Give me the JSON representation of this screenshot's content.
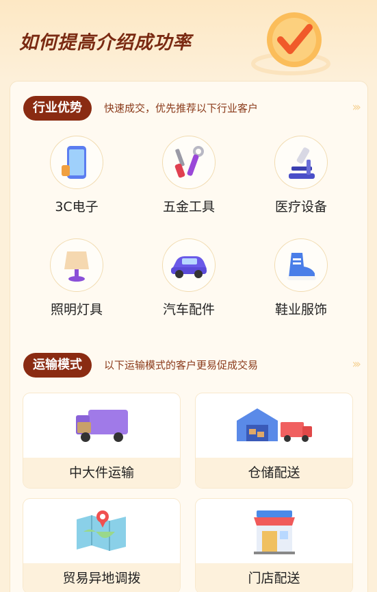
{
  "hero": {
    "title": "如何提高介绍成功率"
  },
  "industry": {
    "tag": "行业优势",
    "desc": "快速成交，优先推荐以下行业客户",
    "items": [
      {
        "label": "3C电子",
        "icon": "phone-icon"
      },
      {
        "label": "五金工具",
        "icon": "tools-icon"
      },
      {
        "label": "医疗设备",
        "icon": "microscope-icon"
      },
      {
        "label": "照明灯具",
        "icon": "lamp-icon"
      },
      {
        "label": "汽车配件",
        "icon": "car-icon"
      },
      {
        "label": "鞋业服饰",
        "icon": "shoe-icon"
      }
    ]
  },
  "transport": {
    "tag": "运输模式",
    "desc": "以下运输模式的客户更易促成交易",
    "items": [
      {
        "label": "中大件运输",
        "icon": "truck-icon"
      },
      {
        "label": "仓储配送",
        "icon": "warehouse-icon"
      },
      {
        "label": "贸易异地调拨",
        "icon": "map-icon"
      },
      {
        "label": "门店配送",
        "icon": "store-icon"
      }
    ]
  },
  "colors": {
    "accent": "#8a2b12",
    "title": "#7a2a12",
    "background": "#fdf0da"
  }
}
